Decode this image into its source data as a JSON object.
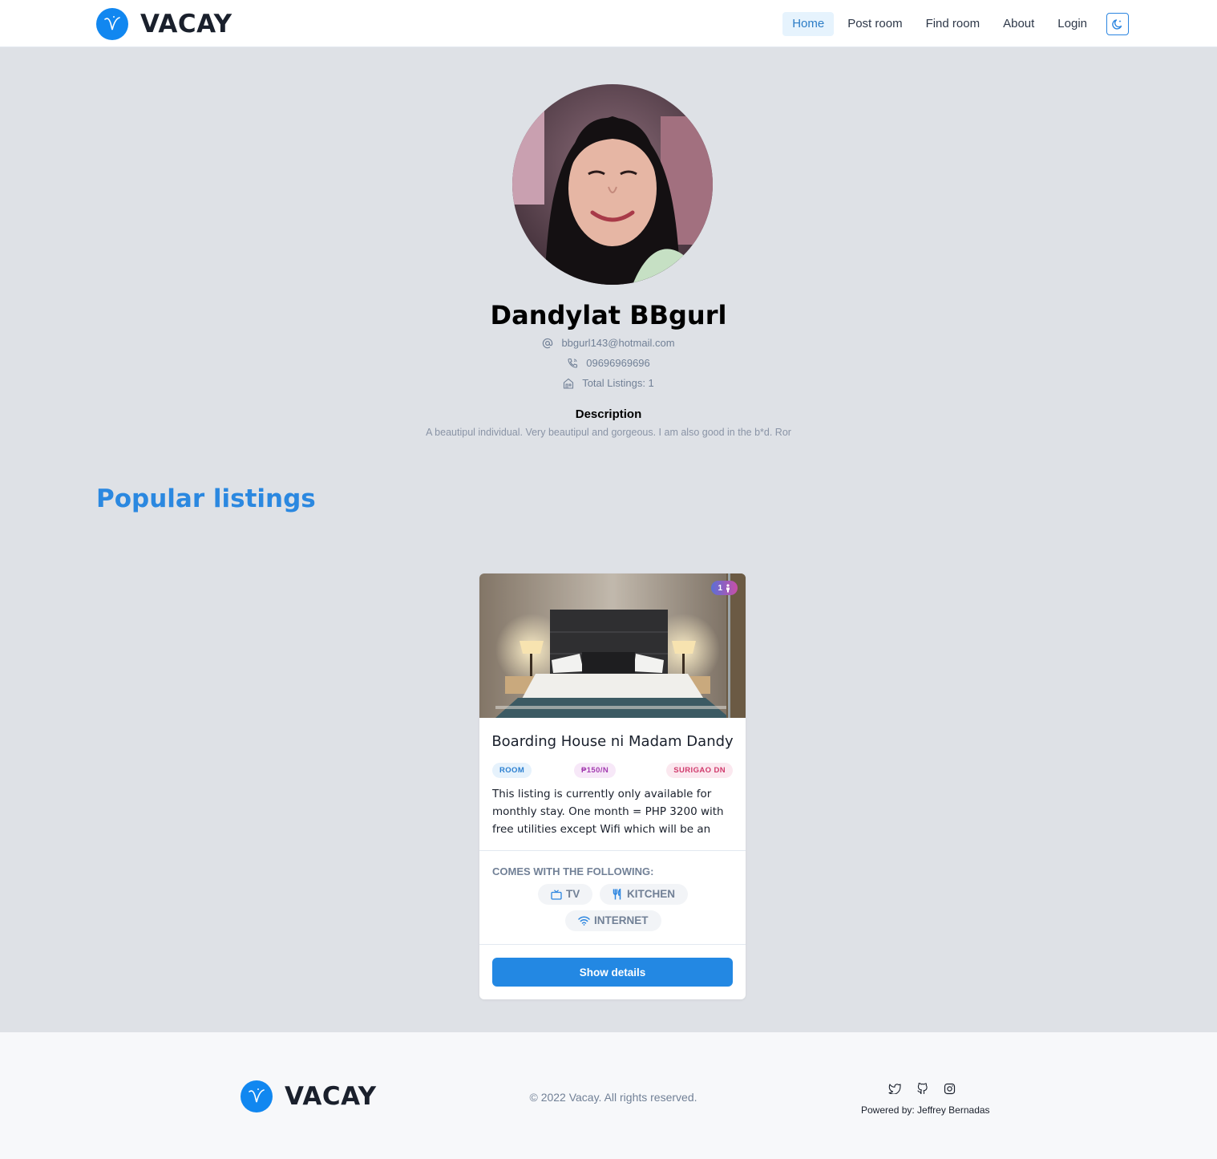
{
  "brand": {
    "name": "VACAY",
    "color": "#1187f0"
  },
  "nav": {
    "items": [
      {
        "label": "Home",
        "active": true
      },
      {
        "label": "Post room"
      },
      {
        "label": "Find room"
      },
      {
        "label": "About"
      },
      {
        "label": "Login"
      }
    ],
    "theme_icon": "moon-icon"
  },
  "profile": {
    "name": "Dandylat BBgurl",
    "email": "bbgurl143@hotmail.com",
    "phone": "09696969696",
    "total_listings": "Total Listings: 1",
    "description_title": "Description",
    "description": "A beautipul individual. Very beautipul and gorgeous. I am also good in the b*d. Ror"
  },
  "section": {
    "title": "Popular listings"
  },
  "listing": {
    "guests": "1",
    "title": "Boarding House ni Madam Dandy",
    "type": "ROOM",
    "price": "₱150/N",
    "location": "SURIGAO DN",
    "description": "This listing is currently only available for monthly stay. One month = PHP 3200 with free utilities except Wifi which will be an additional...",
    "amenities_title": "COMES WITH THE FOLLOWING:",
    "amenities": [
      {
        "label": "TV",
        "icon": "tv-icon"
      },
      {
        "label": "KITCHEN",
        "icon": "utensils-icon"
      },
      {
        "label": "INTERNET",
        "icon": "wifi-icon"
      }
    ],
    "button": "Show details"
  },
  "footer": {
    "brand": "VACAY",
    "copyright": "© 2022 Vacay. All rights reserved.",
    "powered": "Powered by: Jeffrey Bernadas",
    "socials": [
      "twitter-icon",
      "github-icon",
      "instagram-icon"
    ]
  },
  "colors": {
    "accent": "#2388e3",
    "page_bg": "#dee1e6",
    "section_title": "#2b88e0"
  }
}
